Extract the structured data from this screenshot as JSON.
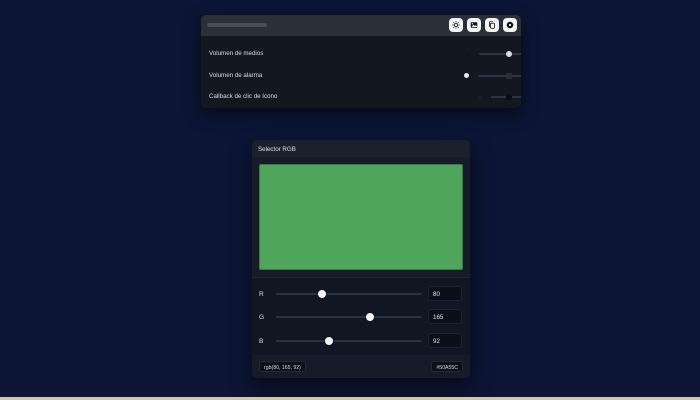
{
  "volume_panel": {
    "toolbar_buttons": [
      {
        "icon": "sun-icon"
      },
      {
        "icon": "image-icon"
      },
      {
        "icon": "copy-icon"
      },
      {
        "icon": "record-icon"
      }
    ],
    "sliders": [
      {
        "label": "Volumen de medios",
        "value": 0.3,
        "lead_icon_color": "#111418",
        "tail_icon": "circle-dot-icon",
        "tail_color": "#d8dbe0"
      },
      {
        "label": "Volumen de alarma",
        "value": 0.55,
        "lead_icon_color": "#e8eaee",
        "tail_icon": "square-icon",
        "tail_color": "#2a2f36"
      },
      {
        "label": "Callback de clic de ícono",
        "value": 0.21,
        "lead_icon_color": "#1a1e24",
        "tail_icon": "filled-circle-icon",
        "tail_color": "#0a0c10"
      }
    ]
  },
  "rgb_picker": {
    "title": "Selector RGB",
    "color_hex": "#50A55C",
    "channels": [
      {
        "label": "R",
        "value": 80
      },
      {
        "label": "G",
        "value": 165
      },
      {
        "label": "B",
        "value": 92
      }
    ],
    "max": 255,
    "rgb_text": "rgb(80, 165, 92)",
    "hex_text": "#50A55C"
  }
}
